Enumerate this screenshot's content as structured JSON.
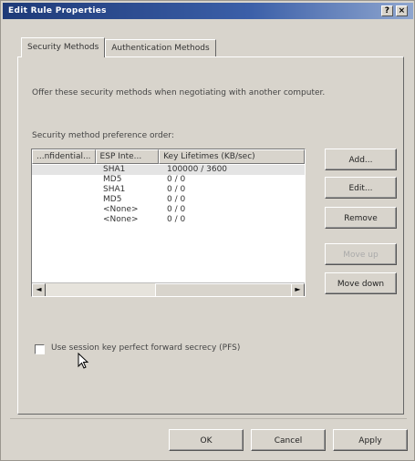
{
  "window": {
    "title": "Edit Rule Properties",
    "help_label": "?",
    "close_label": "×"
  },
  "tabs": [
    {
      "label": "Security Methods",
      "active": true
    },
    {
      "label": "Authentication Methods",
      "active": false
    }
  ],
  "description": "Offer these security methods when negotiating with another computer.",
  "list_label": "Security method preference order:",
  "list": {
    "columns": [
      "...nfidential...",
      "ESP Inte...",
      "Key Lifetimes (KB/sec)"
    ],
    "rows": [
      {
        "conf": "",
        "esp": "SHA1",
        "key": "100000 / 3600"
      },
      {
        "conf": "",
        "esp": "MD5",
        "key": "0 / 0"
      },
      {
        "conf": "",
        "esp": "SHA1",
        "key": "0 / 0"
      },
      {
        "conf": "",
        "esp": "MD5",
        "key": "0 / 0"
      },
      {
        "conf": "",
        "esp": "<None>",
        "key": "0 / 0"
      },
      {
        "conf": "",
        "esp": "<None>",
        "key": "0 / 0"
      }
    ]
  },
  "side_buttons": {
    "add": "Add...",
    "edit": "Edit...",
    "remove": "Remove",
    "move_up": "Move up",
    "move_down": "Move down"
  },
  "pfs_label": "Use session key perfect forward secrecy (PFS)",
  "pfs_checked": false,
  "footer": {
    "ok": "OK",
    "cancel": "Cancel",
    "apply": "Apply"
  },
  "colors": {
    "titlebar_start": "#1e3a78",
    "titlebar_end": "#8fa6cf",
    "dialog_bg": "#d8d4cc"
  },
  "icons": [
    "help-icon",
    "close-icon",
    "scroll-left-icon",
    "scroll-right-icon",
    "mouse-cursor-icon"
  ]
}
